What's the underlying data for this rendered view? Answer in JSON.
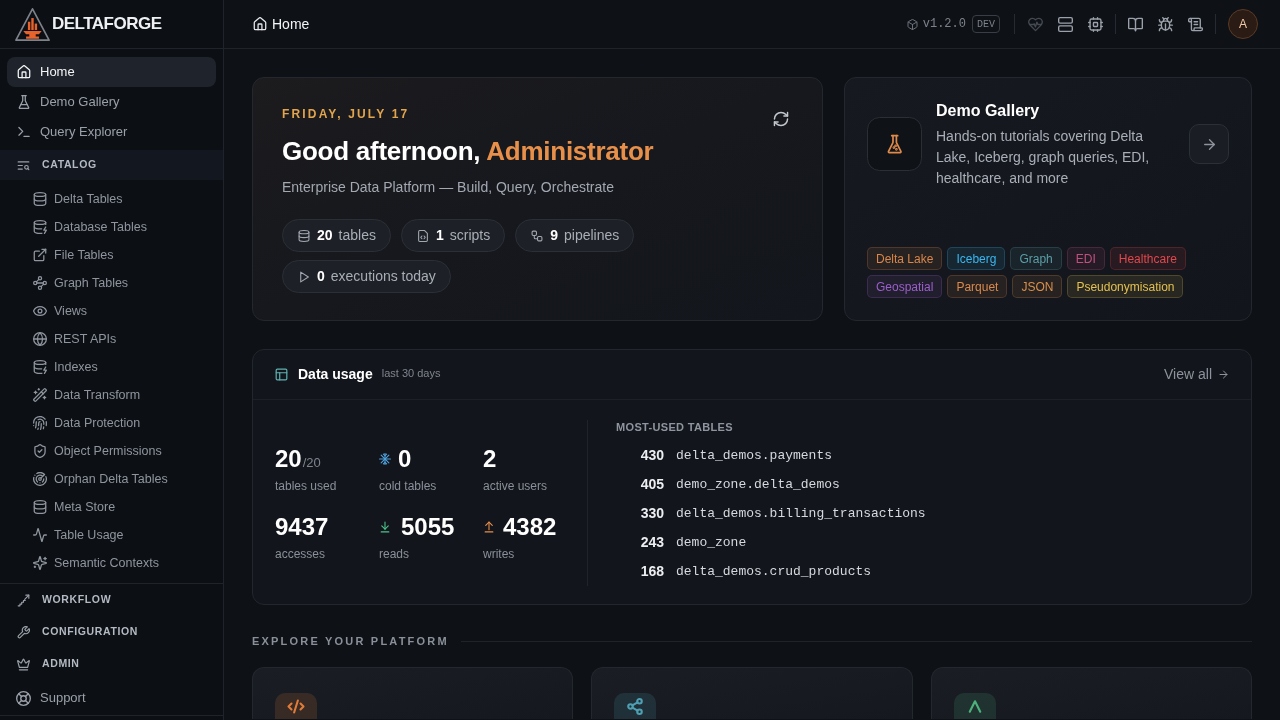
{
  "sidebar": {
    "brand": "DELTAFORGE",
    "items": [
      {
        "label": "Home",
        "selected": true
      },
      {
        "label": "Demo Gallery",
        "selected": false
      },
      {
        "label": "Query Explorer",
        "selected": false
      }
    ],
    "sections": [
      {
        "label": "CATALOG",
        "expanded": true,
        "items": [
          {
            "label": "Delta Tables",
            "selected": false
          },
          {
            "label": "Database Tables",
            "selected": false
          },
          {
            "label": "File Tables",
            "selected": false
          },
          {
            "label": "Graph Tables",
            "selected": false
          },
          {
            "label": "Views",
            "selected": false
          },
          {
            "label": "REST APIs",
            "selected": false
          },
          {
            "label": "Indexes",
            "selected": false
          },
          {
            "label": "Data Transform",
            "selected": false
          },
          {
            "label": "Data Protection",
            "selected": false
          },
          {
            "label": "Object Permissions",
            "selected": false
          },
          {
            "label": "Orphan Delta Tables",
            "selected": false
          },
          {
            "label": "Meta Store",
            "selected": false
          },
          {
            "label": "Table Usage",
            "selected": false
          },
          {
            "label": "Semantic Contexts",
            "selected": false
          }
        ]
      },
      {
        "label": "WORKFLOW",
        "expanded": false
      },
      {
        "label": "CONFIGURATION",
        "expanded": false
      },
      {
        "label": "ADMIN",
        "expanded": false
      }
    ],
    "footer_items": [
      {
        "label": "Support",
        "selected": false
      }
    ]
  },
  "topbar": {
    "breadcrumb": "Home",
    "version": "v1.2.0",
    "environment": "DEV",
    "tools": [
      {
        "disabled": true
      },
      {
        "disabled": false
      },
      {
        "disabled": false
      },
      {
        "disabled": false
      },
      {
        "disabled": false
      },
      {
        "disabled": false
      }
    ],
    "user_initial": "A"
  },
  "welcome": {
    "date": "FRIDAY, JULY 17",
    "greeting": "Good afternoon,",
    "name": "Administrator",
    "subtitle": "Enterprise Data Platform — Build, Query, Orchestrate",
    "stats": [
      {
        "value": "20",
        "label": "tables"
      },
      {
        "value": "1",
        "label": "scripts"
      },
      {
        "value": "9",
        "label": "pipelines"
      },
      {
        "value": "0",
        "label": "executions today"
      }
    ]
  },
  "demo_gallery": {
    "title": "Demo Gallery",
    "description": "Hands-on tutorials covering Delta Lake, Iceberg, graph queries, EDI, healthcare, and more",
    "tags": [
      {
        "label": "Delta Lake",
        "color": "#d9864a"
      },
      {
        "label": "Iceberg",
        "color": "#38b6f0"
      },
      {
        "label": "Graph",
        "color": "#5b9ea6"
      },
      {
        "label": "EDI",
        "color": "#c2507e"
      },
      {
        "label": "Healthcare",
        "color": "#e0484b"
      },
      {
        "label": "Geospatial",
        "color": "#9b5fc9"
      },
      {
        "label": "Parquet",
        "color": "#d98a4a"
      },
      {
        "label": "JSON",
        "color": "#d9904a"
      },
      {
        "label": "Pseudonymisation",
        "color": "#e3c04f"
      }
    ]
  },
  "data_usage": {
    "title": "Data usage",
    "period": "last 30 days",
    "link": "View all",
    "metrics": [
      {
        "value": "20",
        "total": "/20",
        "label": "tables used"
      },
      {
        "value": "0",
        "label": "cold tables"
      },
      {
        "value": "2",
        "label": "active users"
      },
      {
        "value": "9437",
        "label": "accesses"
      },
      {
        "value": "5055",
        "label": "reads"
      },
      {
        "value": "4382",
        "label": "writes"
      }
    ],
    "most_used": {
      "title": "MOST-USED TABLES",
      "rows": [
        {
          "count": "430",
          "name": "delta_demos.payments"
        },
        {
          "count": "405",
          "name": "demo_zone.delta_demos"
        },
        {
          "count": "330",
          "name": "delta_demos.billing_transactions"
        },
        {
          "count": "243",
          "name": "demo_zone"
        },
        {
          "count": "168",
          "name": "delta_demos.crud_products"
        }
      ]
    }
  },
  "explore": {
    "title": "EXPLORE YOUR PLATFORM",
    "cards": [
      {
        "color": "#e07b39"
      },
      {
        "color": "#4f9fb3"
      },
      {
        "color": "#4caf7c"
      }
    ]
  }
}
